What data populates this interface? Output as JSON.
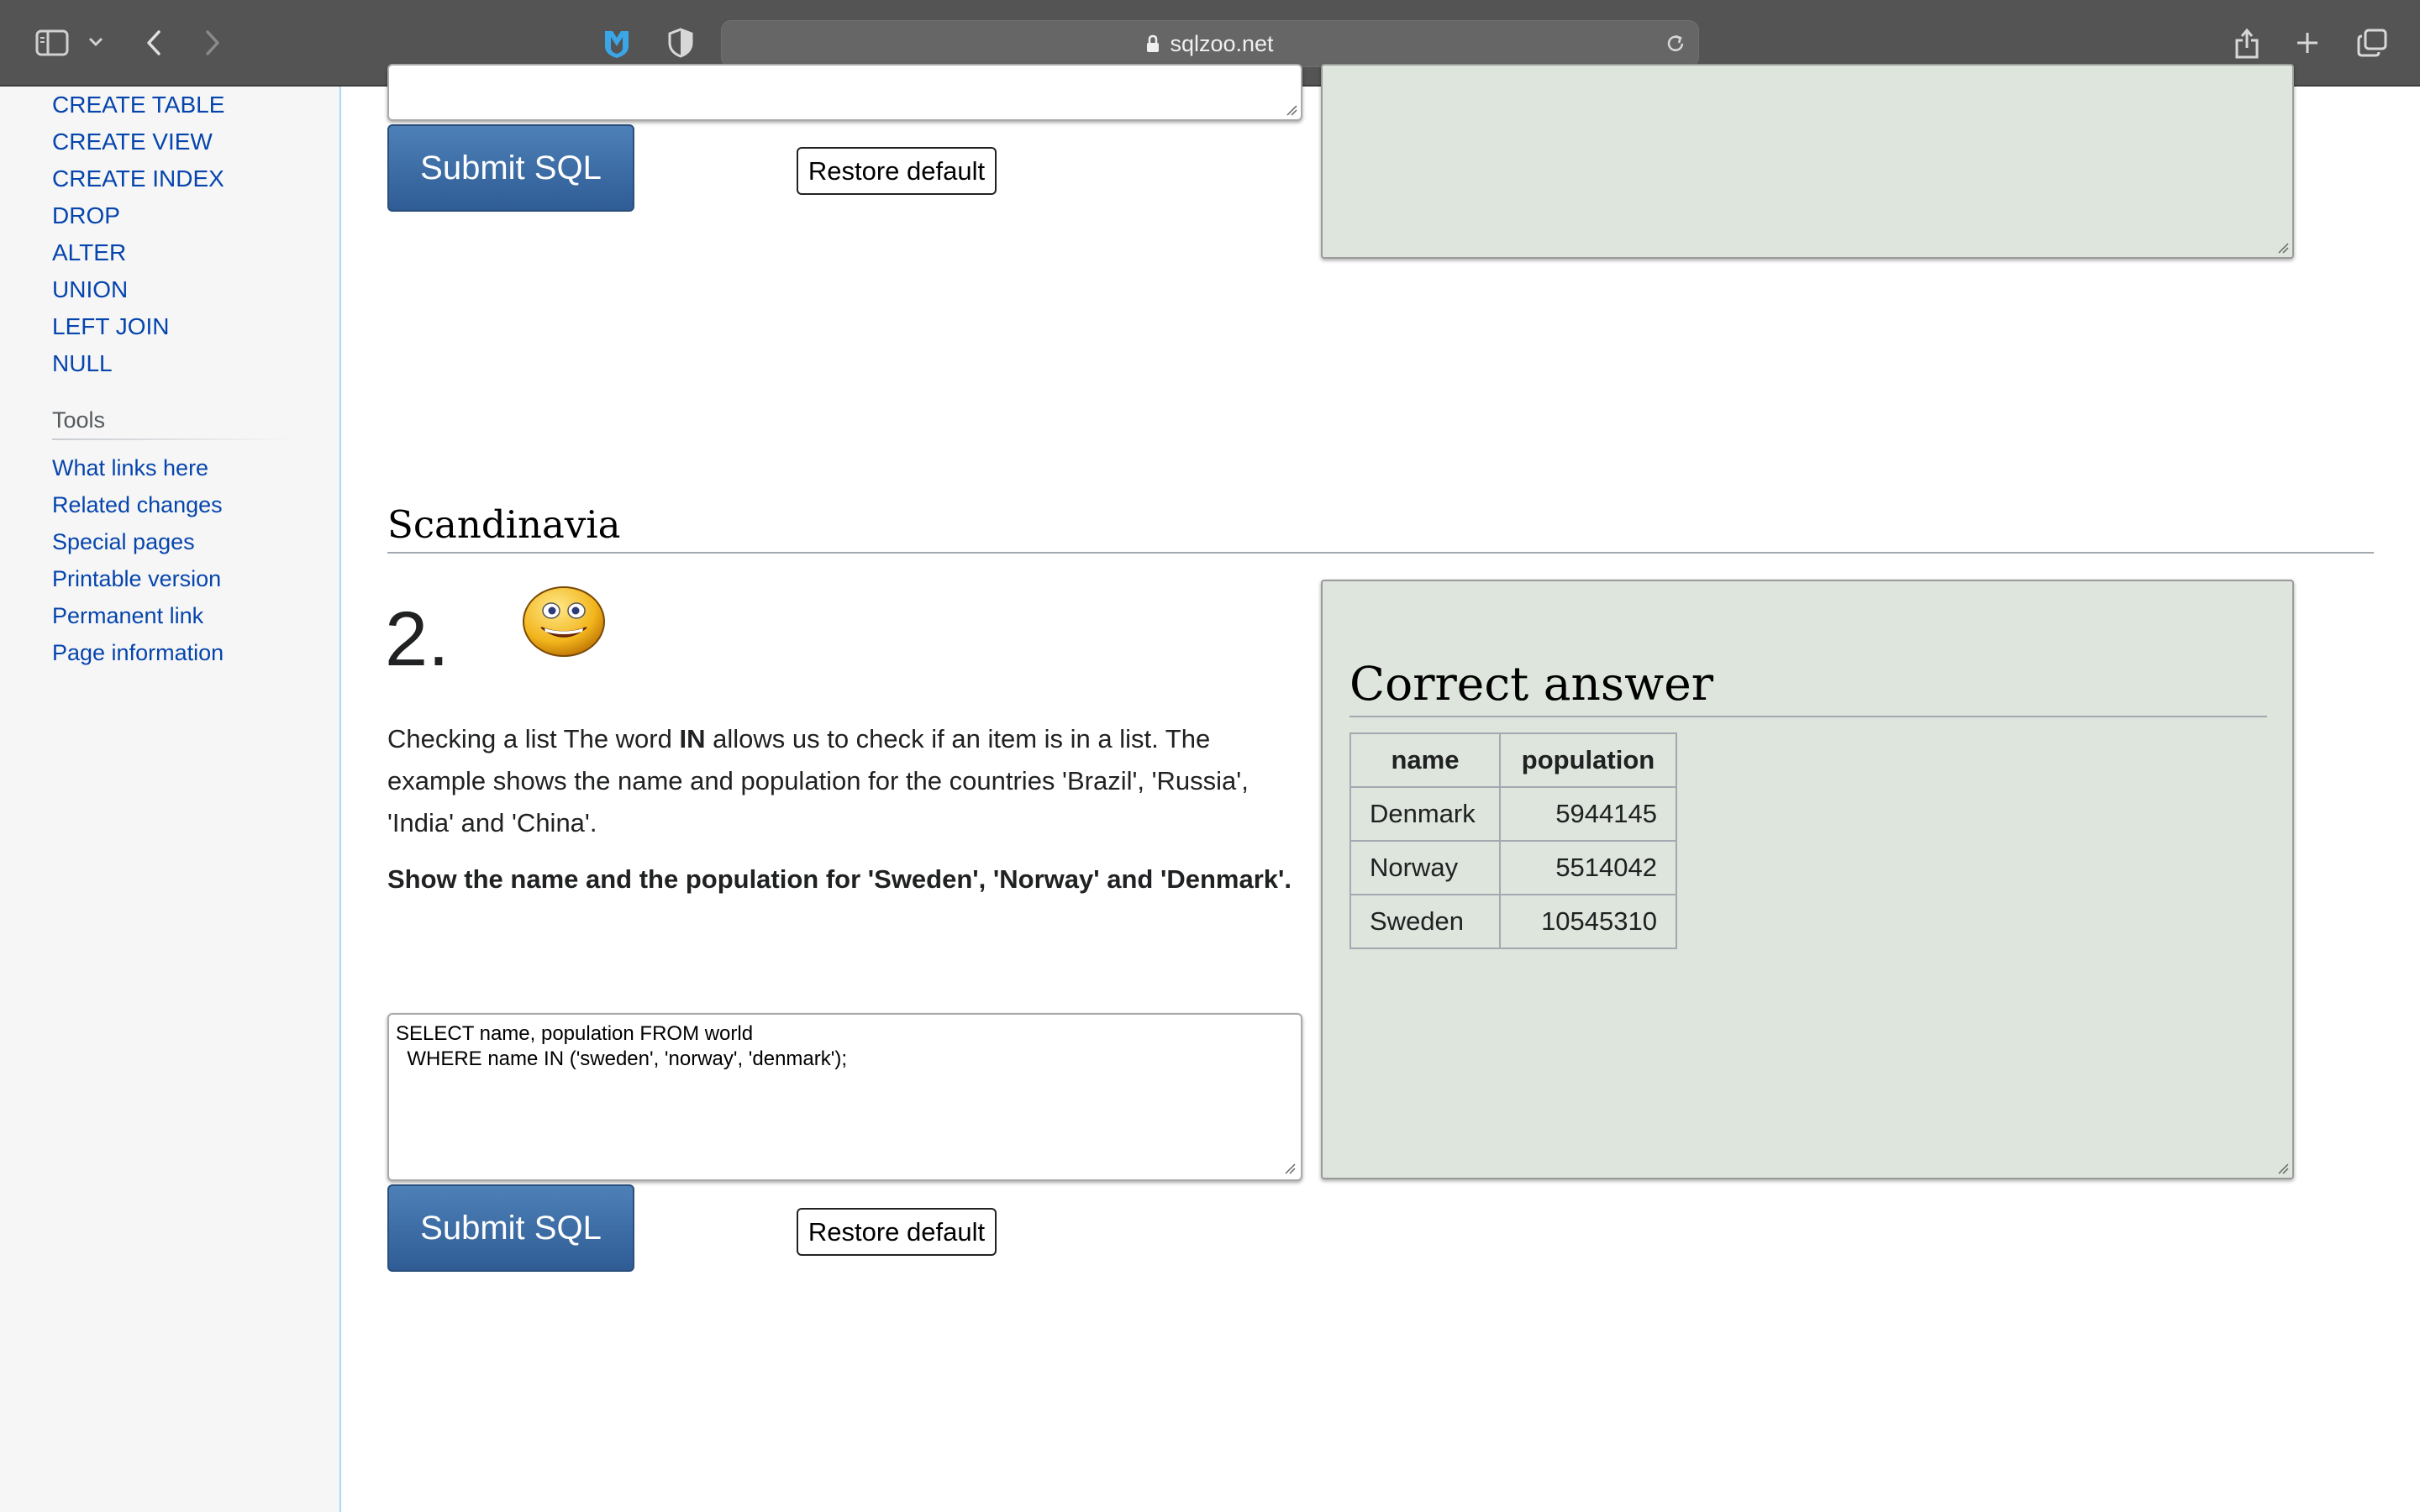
{
  "browser": {
    "url": "sqlzoo.net"
  },
  "sidebar": {
    "nav_items": [
      "CREATE TABLE",
      "CREATE VIEW",
      "CREATE INDEX",
      "DROP",
      "ALTER",
      "UNION",
      "LEFT JOIN",
      "NULL"
    ],
    "tools_heading": "Tools",
    "tools_items": [
      "What links here",
      "Related changes",
      "Special pages",
      "Printable version",
      "Permanent link",
      "Page information"
    ]
  },
  "exercise1": {
    "submit_label": "Submit SQL",
    "restore_label": "Restore default"
  },
  "section": {
    "title": "Scandinavia"
  },
  "exercise2": {
    "number": "2.",
    "intro_pre": "Checking a list The word ",
    "intro_keyword": "IN",
    "intro_post": " allows us to check if an item is in a list. The example shows the name and population for the countries 'Brazil', 'Russia', 'India' and 'China'.",
    "task": "Show the name and the population for 'Sweden', 'Norway' and 'Denmark'.",
    "sql": "SELECT name, population FROM world\n  WHERE name IN ('sweden', 'norway', 'denmark');",
    "submit_label": "Submit SQL",
    "restore_label": "Restore default",
    "answer": {
      "title": "Correct answer",
      "headers": [
        "name",
        "population"
      ],
      "rows": [
        [
          "Denmark",
          "5944145"
        ],
        [
          "Norway",
          "5514042"
        ],
        [
          "Sweden",
          "10545310"
        ]
      ]
    }
  }
}
